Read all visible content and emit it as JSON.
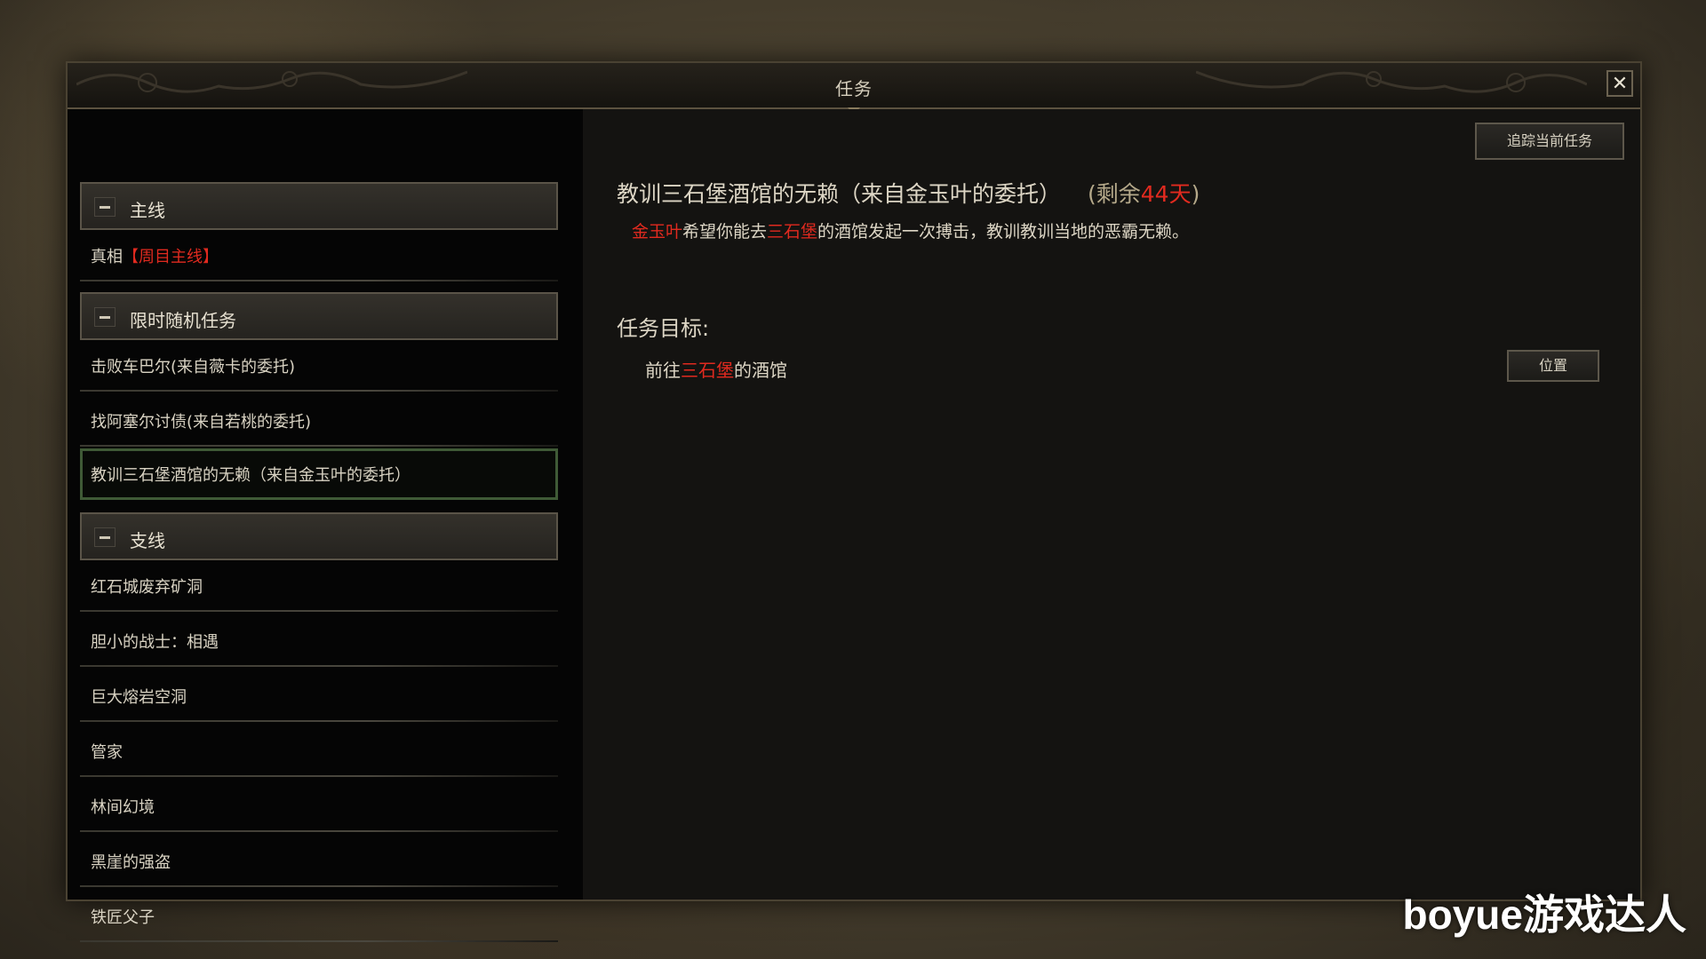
{
  "window": {
    "title": "任务",
    "close_icon": "close-icon"
  },
  "quest_list": {
    "categories": [
      {
        "label": "主线",
        "items": [
          {
            "label": "真相",
            "tag": "【周目主线】"
          }
        ]
      },
      {
        "label": "限时随机任务",
        "items": [
          {
            "label": "击败车巴尔(来自薇卡的委托)"
          },
          {
            "label": "找阿塞尔讨债(来自若桃的委托)"
          },
          {
            "label": "教训三石堡酒馆的无赖（来自金玉叶的委托）",
            "selected": true
          }
        ]
      },
      {
        "label": "支线",
        "items": [
          {
            "label": "红石城废弃矿洞"
          },
          {
            "label": "胆小的战士：相遇"
          },
          {
            "label": "巨大熔岩空洞"
          },
          {
            "label": "管家"
          },
          {
            "label": "林间幻境"
          },
          {
            "label": "黑崖的强盗"
          },
          {
            "label": "铁匠父子"
          }
        ]
      }
    ]
  },
  "detail": {
    "track_button": "追踪当前任务",
    "title": "教训三石堡酒馆的无赖（来自金玉叶的委托）",
    "remain_prefix": "(剩余",
    "remain_days": "44天",
    "remain_suffix": ")",
    "desc_npc": "金玉叶",
    "desc_part1": "希望你能去",
    "desc_place": "三石堡",
    "desc_part2": "的酒馆发起一次搏击，教训教训当地的恶霸无赖。",
    "objective_heading": "任务目标:",
    "objective_prefix": "前往",
    "objective_place": "三石堡",
    "objective_suffix": "的酒馆",
    "location_button": "位置"
  },
  "colors": {
    "highlight_red": "#e12a1f",
    "selected_border": "#3f5a36"
  },
  "watermark": "boyue游戏达人"
}
